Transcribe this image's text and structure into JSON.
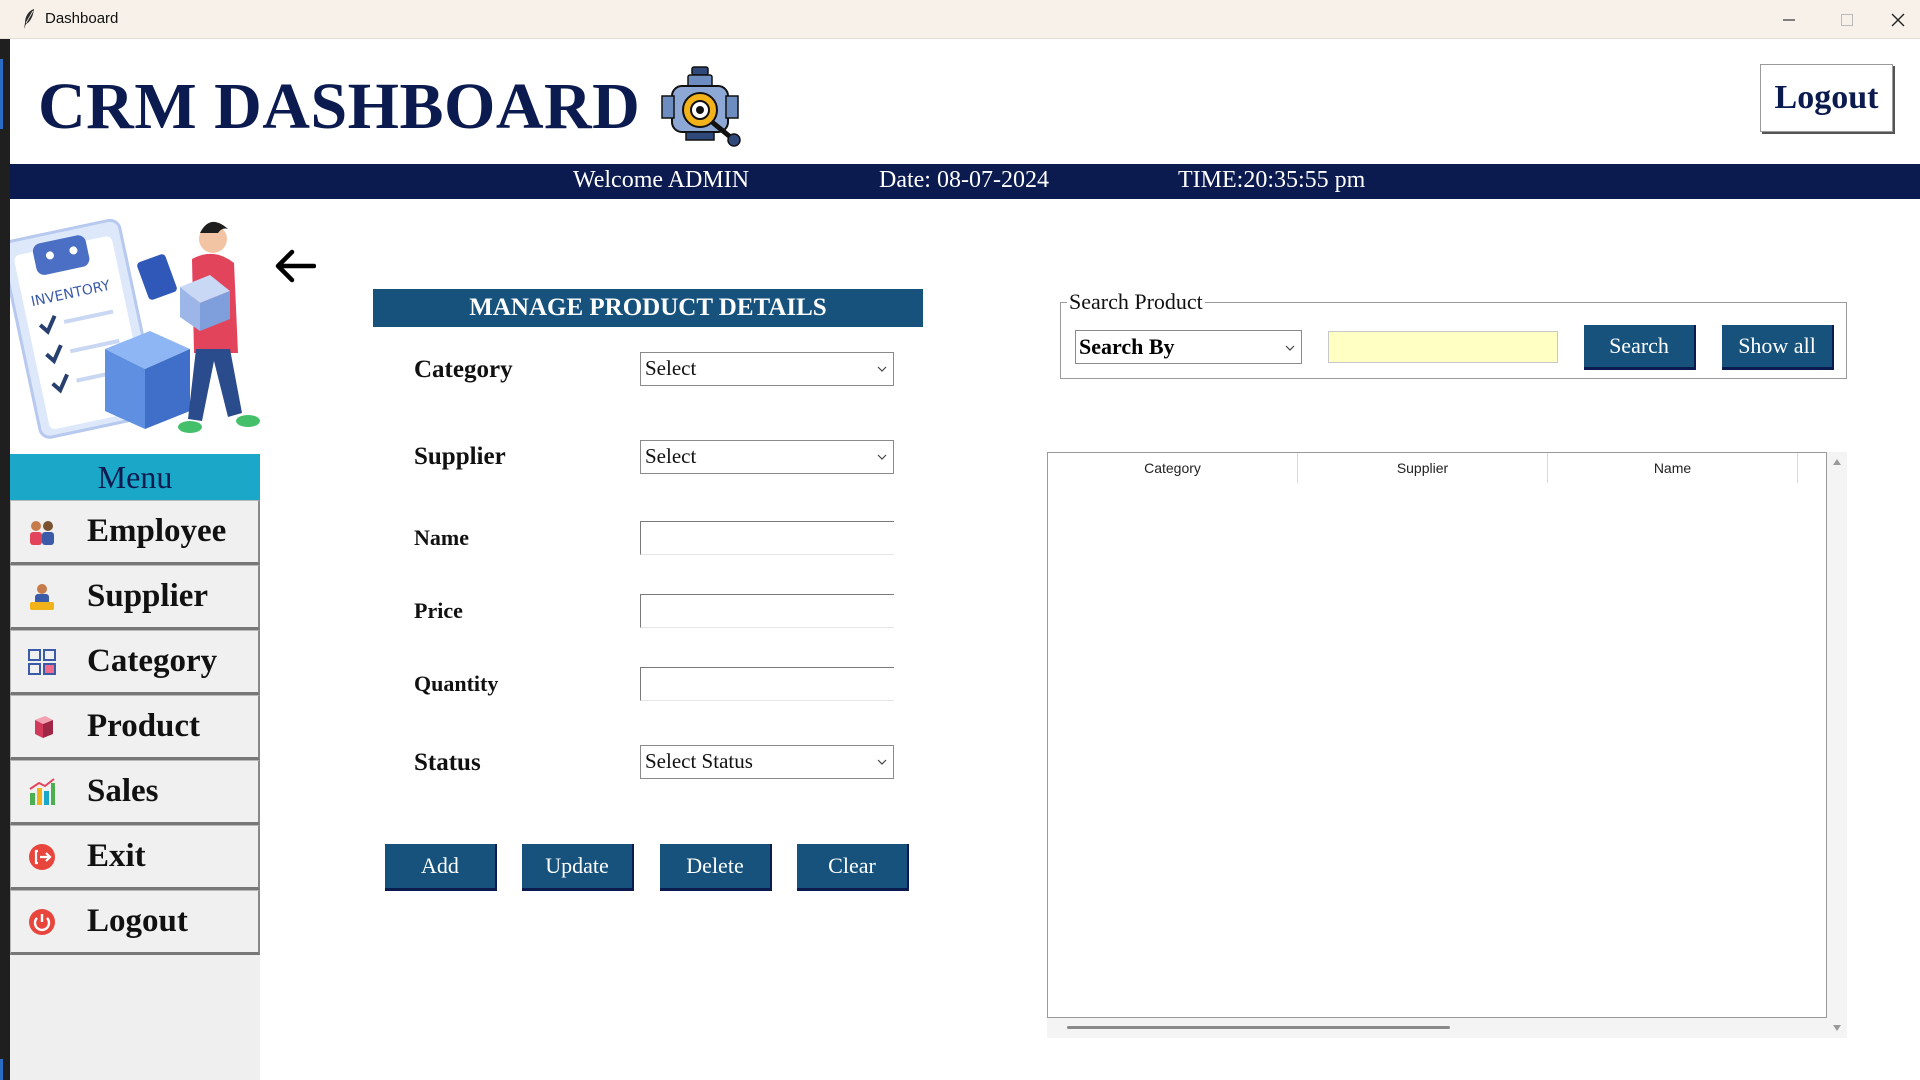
{
  "window": {
    "title": "Dashboard"
  },
  "header": {
    "title": "CRM DASHBOARD",
    "logout_label": "Logout"
  },
  "infobar": {
    "welcome": "Welcome ADMIN",
    "date": "Date: 08-07-2024",
    "time": "TIME:20:35:55 pm"
  },
  "sidebar": {
    "art_text": "INVENTORY",
    "menu_title": "Menu",
    "items": [
      {
        "label": "Employee",
        "icon": "employee-icon"
      },
      {
        "label": "Supplier",
        "icon": "supplier-icon"
      },
      {
        "label": "Category",
        "icon": "category-icon"
      },
      {
        "label": "Product",
        "icon": "product-icon"
      },
      {
        "label": "Sales",
        "icon": "sales-icon"
      },
      {
        "label": "Exit",
        "icon": "exit-icon"
      },
      {
        "label": "Logout",
        "icon": "power-icon"
      }
    ]
  },
  "form": {
    "title": "MANAGE PRODUCT DETAILS",
    "category_label": "Category",
    "category_value": "Select",
    "supplier_label": "Supplier",
    "supplier_value": "Select",
    "name_label": "Name",
    "name_value": "",
    "price_label": "Price",
    "price_value": "",
    "quantity_label": "Quantity",
    "quantity_value": "",
    "status_label": "Status",
    "status_value": "Select Status",
    "buttons": {
      "add": "Add",
      "update": "Update",
      "delete": "Delete",
      "clear": "Clear"
    }
  },
  "search": {
    "legend": "Search Product",
    "search_by": "Search By",
    "query": "",
    "search_button": "Search",
    "show_all_button": "Show all"
  },
  "table": {
    "columns": [
      "Category",
      "Supplier",
      "Name"
    ],
    "rows": []
  },
  "colors": {
    "navy": "#0b1a4f",
    "button_blue": "#16527c",
    "menu_cyan": "#1aa7c8",
    "search_yellow": "#ffffc4"
  }
}
